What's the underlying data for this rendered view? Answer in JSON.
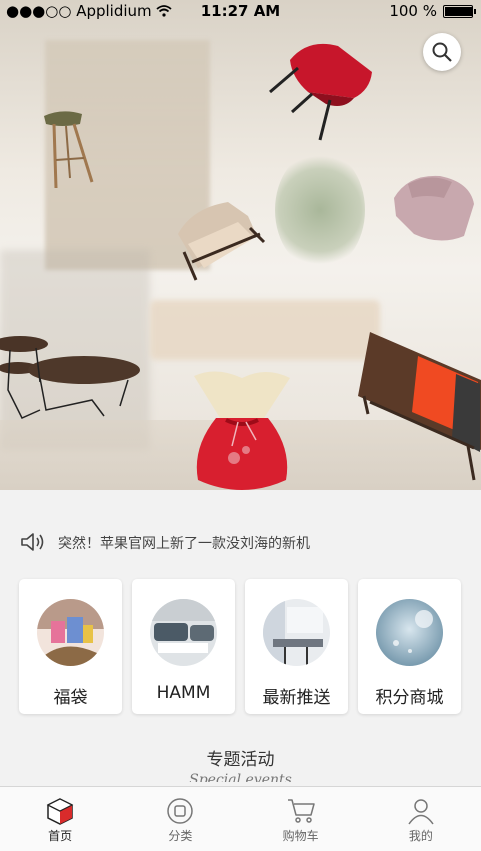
{
  "status_bar": {
    "carrier": "●●●○○ Applidium",
    "time": "11:27 AM",
    "battery_text": "100 %",
    "battery_level": 1.0
  },
  "hero": {
    "search_icon": "search-icon",
    "items": [
      "stool-icon",
      "red-chair-icon",
      "armchair-icon",
      "pouf-icon",
      "coffee-tables-icon",
      "sideboard-icon",
      "lucky-bag-icon"
    ]
  },
  "notice": {
    "icon": "speaker-icon",
    "text": "突然！苹果官网上新了一款没刘海的新机"
  },
  "categories": [
    {
      "label": "福袋"
    },
    {
      "label": "HAMM"
    },
    {
      "label": "最新推送"
    },
    {
      "label": "积分商城"
    }
  ],
  "special": {
    "title": "专题活动",
    "subtitle": "Special events"
  },
  "tabbar": {
    "tabs": [
      {
        "label": "首页",
        "icon": "home-cube-icon",
        "active": true
      },
      {
        "label": "分类",
        "icon": "category-circle-icon",
        "active": false
      },
      {
        "label": "购物车",
        "icon": "shopping-cart-icon",
        "active": false
      },
      {
        "label": "我的",
        "icon": "user-icon",
        "active": false
      }
    ]
  },
  "colors": {
    "accent_red": "#d92b2b",
    "background": "#f2f2f2"
  }
}
